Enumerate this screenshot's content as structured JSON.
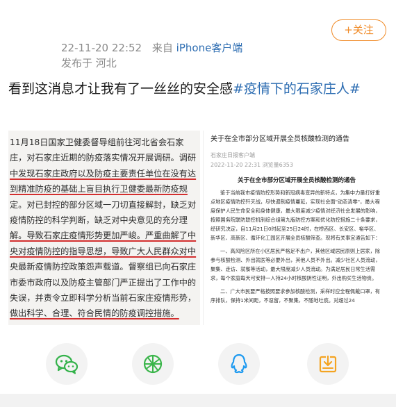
{
  "post": {
    "timestamp": "22-11-20 22:52",
    "from_label": "来自",
    "source": "iPhone客户端",
    "location": "发布于 河北",
    "text_prefix": "看到这消息才让我有了一丝丝的安全感",
    "hashtag": "#疫情下的石家庄人#"
  },
  "follow_button": {
    "label": "+关注"
  },
  "images": {
    "left": {
      "lines": [
        "11月18日国家卫健委督导组前往河北省会石家",
        "庄，对石家庄近期的防疫落实情况开展调研。调研",
        "中发现石家庄政府以及防疫主要责任单位在没有达",
        "到精准防疫的基础上盲目执行卫健委最新防疫规",
        "定。对已封控的部分区域一刀切直接解封，缺乏对",
        "疫情防控的科学判断，缺乏对中央意见的充分理",
        "解。导致石家庄疫情形势更加严峻。严重曲解了中",
        "央对疫情防控的指导思想，导致广大人民群众对中",
        "央最新疫情防控政策怨声载道。督察组已向石家庄",
        "市委市政府以及防疫主管部门严正提出了工作中的",
        "失误，并责令立即科学分析当前石家庄疫情形势，",
        "做出科学、合理、符合民情的防疫调控措施。"
      ]
    },
    "right": {
      "title": "关于在全市部分区域开展全员核酸检测的通告",
      "source": "石家庄日报客户端",
      "time": "2022-11-20 22:31  浏览量6353",
      "heading": "关于在全市部分区域开展全员核酸检测的通告",
      "paragraphs": [
        "鉴于当前我市疫情防控形势和新冠病毒变异的新特点，为集中力量打好重点地区疫情防控歼灭战，尽快遏制疫情蔓延，实现社会面\"动态清零\"，最大程度保护人民生命安全和身体健康，最大限度减少疫情对经济社会发展的影响，按照国务院联防联控机制综合组第九版防控方案和优化防控措施二十条要求，经研究决定，自11月21日0时起至25日24时，在桥西区、长安区、裕华区、新华区、高新区、循环化工园区开展全员核酸筛查。现将有关事宜通告如下：",
        "一、高风险区所在小区居民严格足不出户，其他区域居民原则上居家，除参与核酸检测、外出就医等必要外出，其他人员不外出。减少社区人员流动，聚集、走访、就餐等活动，最大限度减少人员流动。为满足居民日常生活需求，每个家庭每天可安排一人持24小时核酸阴性证明，外出购买生活物资。",
        "二、广大市民要严格按照要求参加核酸检测，采样时应全程佩戴口罩，有序排队，保持1米间距，不逗留，不聚集，不随地吐痰。对超过24"
      ]
    }
  },
  "actions": [
    {
      "name": "wechat-share",
      "icon": "wechat-icon",
      "color": "#33b24a"
    },
    {
      "name": "moments-share",
      "icon": "moments-icon",
      "color": "#3ab54a"
    },
    {
      "name": "qq-share",
      "icon": "qq-icon",
      "color": "#1e9af0"
    },
    {
      "name": "save-image",
      "icon": "save-icon",
      "color": "#f4a422"
    }
  ]
}
